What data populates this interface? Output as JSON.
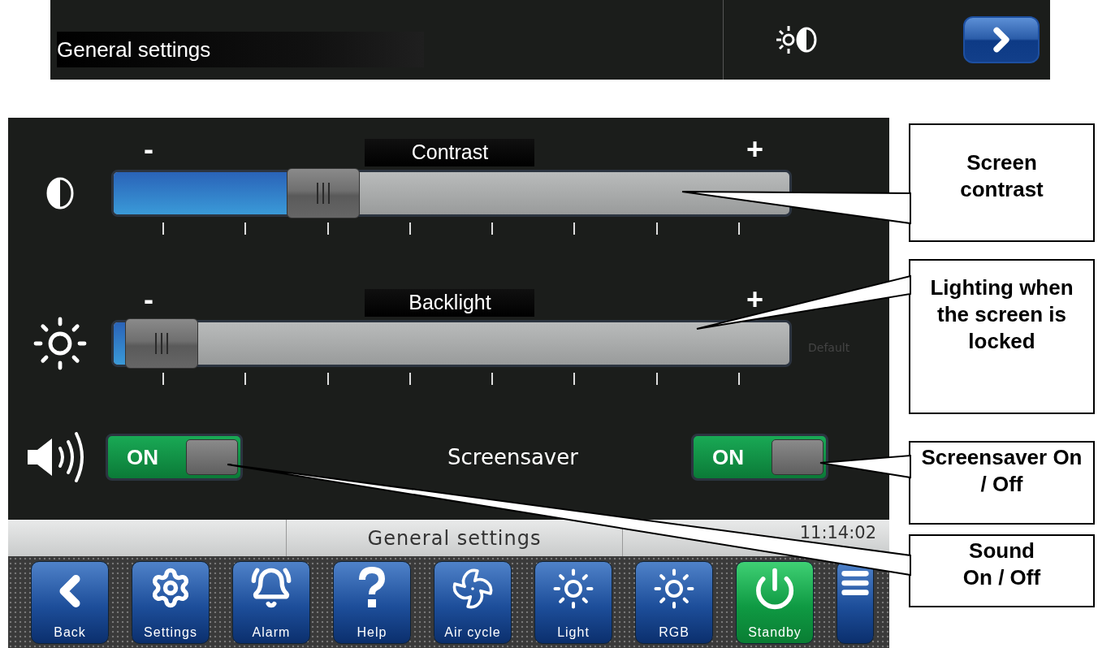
{
  "top_bar": {
    "title": "General settings"
  },
  "sliders": [
    {
      "kind": "contrast",
      "label": "Contrast",
      "minus": "-",
      "plus": "+",
      "level": 0.26
    },
    {
      "kind": "backlight",
      "label": "Backlight",
      "minus": "-",
      "plus": "+",
      "level": 0.02,
      "default_label": "Default"
    }
  ],
  "sound_toggle": {
    "label": "ON",
    "on": true
  },
  "screensaver": {
    "label": "Screensaver",
    "toggle": {
      "label": "ON",
      "on": true
    }
  },
  "status_bar": {
    "title": "General settings",
    "time": "11:14:02"
  },
  "dock": [
    {
      "kind": "back",
      "label": "Back",
      "active": false
    },
    {
      "kind": "settings",
      "label": "Settings",
      "active": false
    },
    {
      "kind": "alarm",
      "label": "Alarm",
      "active": false
    },
    {
      "kind": "help",
      "label": "Help",
      "active": false
    },
    {
      "kind": "fan",
      "label": "Air cycle",
      "active": false
    },
    {
      "kind": "light",
      "label": "Light",
      "active": false
    },
    {
      "kind": "rgb",
      "label": "RGB",
      "active": false
    },
    {
      "kind": "standby",
      "label": "Standby",
      "active": true
    },
    {
      "kind": "menu",
      "active": false
    }
  ],
  "callouts": [
    {
      "text": "Screen contrast"
    },
    {
      "text": "Lighting when the screen is locked"
    },
    {
      "text": "Screensaver On / Off"
    },
    {
      "text": "Sound On / Off"
    }
  ]
}
